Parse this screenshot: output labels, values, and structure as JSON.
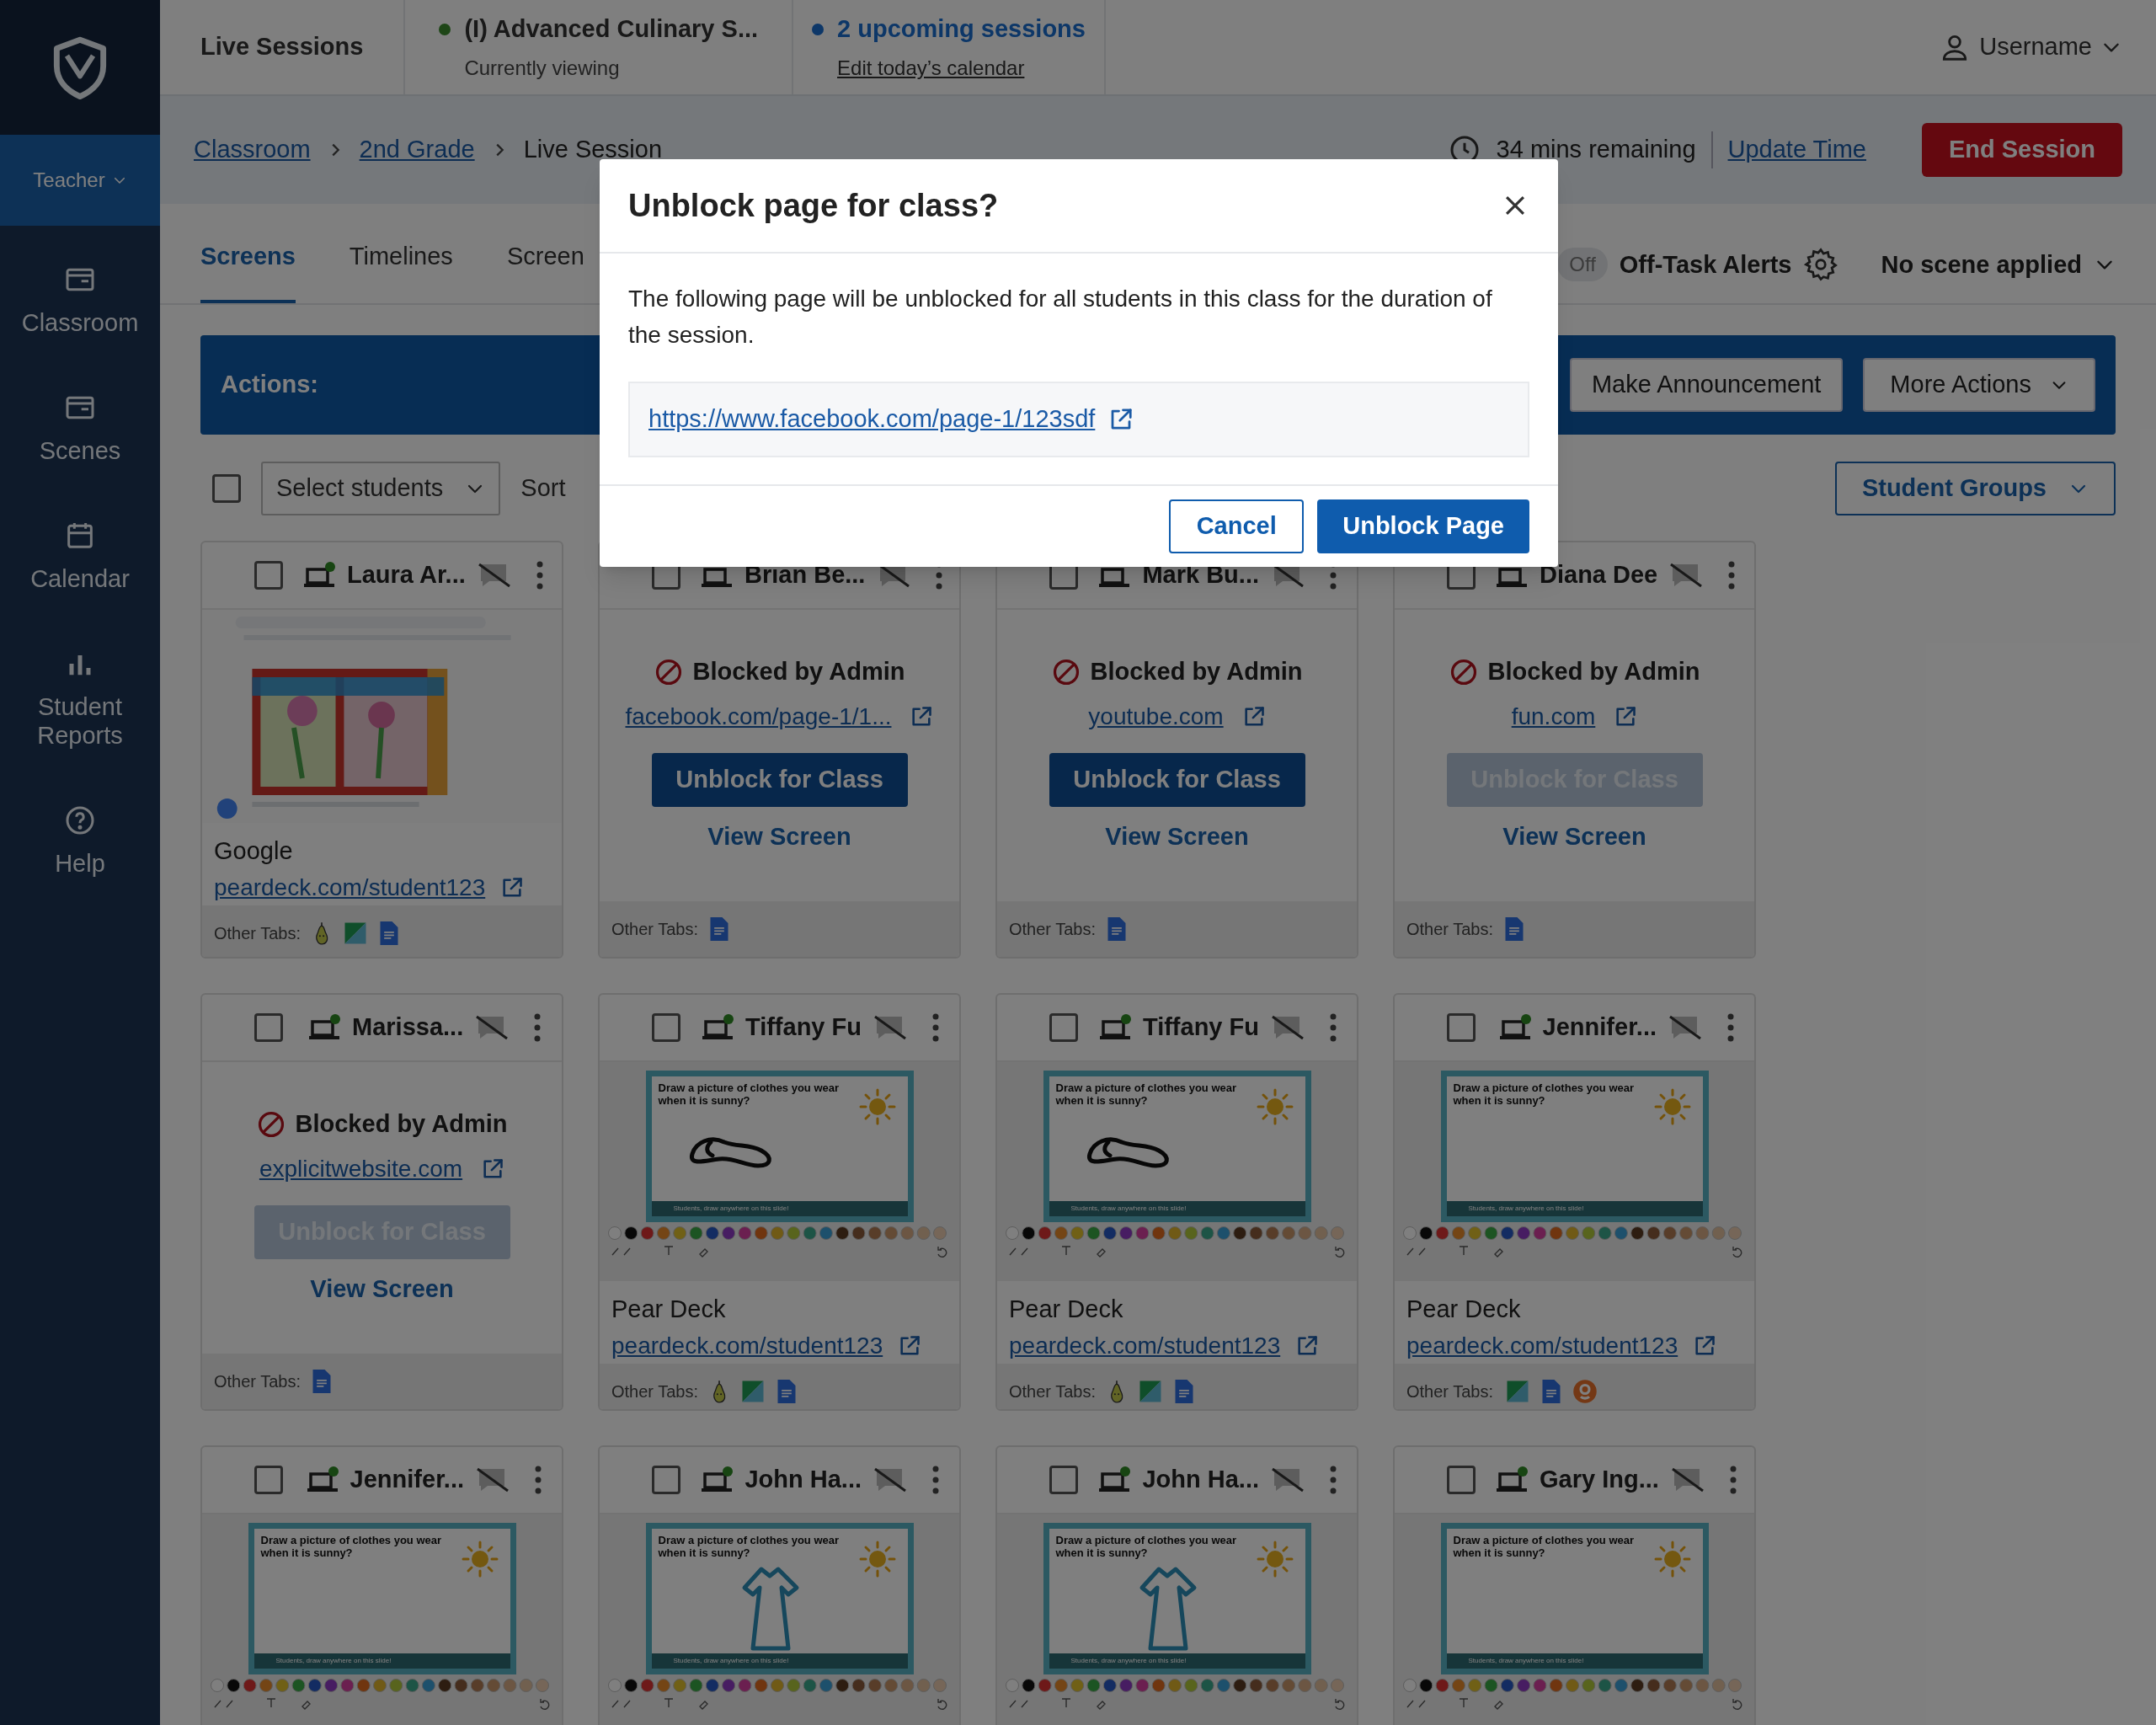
{
  "sidebar": {
    "items": [
      {
        "label": "Teacher",
        "kind": "role",
        "selected": true
      },
      {
        "label": "Classroom",
        "kind": "nav",
        "selected": false
      },
      {
        "label": "Scenes",
        "kind": "nav",
        "selected": false
      },
      {
        "label": "Calendar",
        "kind": "nav",
        "selected": false
      },
      {
        "label": "Student Reports",
        "kind": "nav",
        "selected": false
      },
      {
        "label": "Help",
        "kind": "nav",
        "selected": false
      }
    ]
  },
  "top_bar": {
    "title": "Live Sessions",
    "current_session": {
      "name": "(I) Advanced Culinary S...",
      "subtitle": "Currently viewing"
    },
    "upcoming": {
      "label": "2 upcoming sessions",
      "link": "Edit today’s calendar"
    },
    "user": "Username"
  },
  "breadcrumbs": [
    {
      "label": "Classroom",
      "link": true
    },
    {
      "label": "2nd Grade",
      "link": true
    },
    {
      "label": "Live Session",
      "link": false
    }
  ],
  "timer": {
    "remaining": "34 mins remaining",
    "action": "Update Time"
  },
  "end_button": "End Session",
  "tabs": [
    {
      "label": "Screens",
      "selected": true
    },
    {
      "label": "Timelines",
      "selected": false
    },
    {
      "label": "Screen",
      "selected": false
    }
  ],
  "off_task": {
    "toggle": "Off",
    "on": false,
    "label": "Off-Task Alerts"
  },
  "scene": "No scene applied",
  "actions": {
    "label": "Actions:",
    "buttons": [
      {
        "label": "Make Announcement",
        "kind": "button"
      },
      {
        "label": "More Actions",
        "kind": "dropdown"
      }
    ]
  },
  "toolbar": {
    "select_all_checked": false,
    "select": "Select students",
    "sort": "Sort",
    "groups": "Student Groups"
  },
  "students": [
    {
      "name": "Laura Ar...",
      "checked": false,
      "online": true,
      "kind": "screen",
      "app": "Google",
      "url": "peardeck.com/student123",
      "other_tabs_label": "Other Tabs:",
      "other_tabs": [
        {
          "kind": "pear"
        },
        {
          "kind": "slides"
        },
        {
          "kind": "docs"
        }
      ]
    },
    {
      "name": "Brian Be...",
      "checked": false,
      "online": false,
      "kind": "blocked",
      "message": "Blocked by Admin",
      "url": "facebook.com/page-1/1...",
      "button": "Unblock for Class",
      "disabled": false,
      "view": "View Screen",
      "other_tabs_label": "Other Tabs:",
      "other_tabs": [
        {
          "kind": "docs"
        }
      ]
    },
    {
      "name": "Mark Bu...",
      "checked": false,
      "online": false,
      "kind": "blocked",
      "message": "Blocked by Admin",
      "url": "youtube.com",
      "button": "Unblock for Class",
      "disabled": false,
      "view": "View Screen",
      "other_tabs_label": "Other Tabs:",
      "other_tabs": [
        {
          "kind": "docs"
        }
      ]
    },
    {
      "name": "Diana Dee",
      "checked": false,
      "online": false,
      "kind": "blocked",
      "message": "Blocked by Admin",
      "url": "fun.com",
      "button": "Unblock for Class",
      "disabled": true,
      "view": "View Screen",
      "other_tabs_label": "Other Tabs:",
      "other_tabs": [
        {
          "kind": "docs"
        }
      ]
    },
    {
      "name": "Marissa...",
      "checked": false,
      "online": true,
      "kind": "blocked",
      "message": "Blocked by Admin",
      "url": "explicitwebsite.com",
      "button": "Unblock for Class",
      "disabled": true,
      "view": "View Screen",
      "other_tabs_label": "Other Tabs:",
      "other_tabs": [
        {
          "kind": "docs"
        }
      ]
    },
    {
      "name": "Tiffany Fu",
      "checked": false,
      "online": true,
      "kind": "screen",
      "thumbnail": {
        "kind": "slide",
        "prompt": "Draw a picture of clothes you wear when it is sunny?",
        "footer": "Students, draw anywhere on this slide!",
        "drawing": {
          "kind": "shoe"
        }
      },
      "app": "Pear Deck",
      "url": "peardeck.com/student123",
      "other_tabs_label": "Other Tabs:",
      "other_tabs": [
        {
          "kind": "pear"
        },
        {
          "kind": "slides"
        },
        {
          "kind": "docs"
        }
      ]
    },
    {
      "name": "Tiffany Fu",
      "checked": false,
      "online": true,
      "kind": "screen",
      "thumbnail": {
        "kind": "slide",
        "prompt": "Draw a picture of clothes you wear when it is sunny?",
        "footer": "Students, draw anywhere on this slide!",
        "drawing": {
          "kind": "shoe"
        }
      },
      "app": "Pear Deck",
      "url": "peardeck.com/student123",
      "other_tabs_label": "Other Tabs:",
      "other_tabs": [
        {
          "kind": "pear"
        },
        {
          "kind": "slides"
        },
        {
          "kind": "docs"
        }
      ]
    },
    {
      "name": "Jennifer...",
      "checked": false,
      "online": true,
      "kind": "screen",
      "thumbnail": {
        "kind": "slide",
        "prompt": "Draw a picture of clothes you wear when it is sunny?",
        "footer": "Students, draw anywhere on this slide!"
      },
      "app": "Pear Deck",
      "url": "peardeck.com/student123",
      "other_tabs_label": "Other Tabs:",
      "other_tabs": [
        {
          "kind": "slides"
        },
        {
          "kind": "docs"
        },
        {
          "kind": "orange"
        }
      ]
    },
    {
      "name": "Jennifer...",
      "checked": false,
      "online": true,
      "kind": "screen",
      "thumbnail": {
        "kind": "slide",
        "prompt": "Draw a picture of clothes you wear when it is sunny?",
        "footer": "Students, draw anywhere on this slide!"
      }
    },
    {
      "name": "John Ha...",
      "checked": false,
      "online": true,
      "kind": "screen",
      "thumbnail": {
        "kind": "slide",
        "prompt": "Draw a picture of clothes you wear when it is sunny?",
        "footer": "Students, draw anywhere on this slide!",
        "drawing": {
          "kind": "shirt"
        }
      }
    },
    {
      "name": "John Ha...",
      "checked": false,
      "online": true,
      "kind": "screen",
      "thumbnail": {
        "kind": "slide",
        "prompt": "Draw a picture of clothes you wear when it is sunny?",
        "footer": "Students, draw anywhere on this slide!",
        "drawing": {
          "kind": "shirt"
        }
      }
    },
    {
      "name": "Gary Ing...",
      "checked": false,
      "online": true,
      "kind": "screen",
      "thumbnail": {
        "kind": "slide",
        "prompt": "Draw a picture of clothes you wear when it is sunny?",
        "footer": "Students, draw anywhere on this slide!"
      }
    }
  ],
  "modal": {
    "title": "Unblock page for class?",
    "body": "The following page will be unblocked for all students in this class for the duration of the session.",
    "url": "https://www.facebook.com/page-1/123sdf",
    "cancel": "Cancel",
    "confirm": "Unblock Page"
  }
}
